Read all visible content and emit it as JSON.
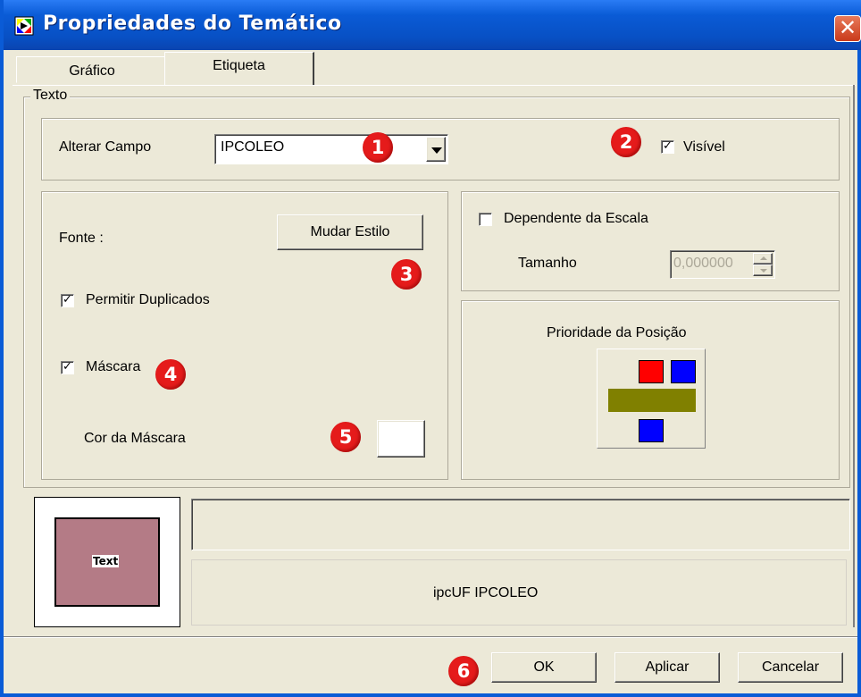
{
  "window": {
    "title": "Propriedades do Temático",
    "close_label": "✕"
  },
  "tabs": [
    {
      "label": "Gráfico",
      "active": false
    },
    {
      "label": "Etiqueta",
      "active": true
    }
  ],
  "texto_group": {
    "label": "Texto"
  },
  "campo": {
    "label": "Alterar Campo",
    "value": "IPCOLEO"
  },
  "visivel": {
    "label": "Visível",
    "checked": true
  },
  "fonte": {
    "label": "Fonte :",
    "button": "Mudar Estilo"
  },
  "permitir_duplicados": {
    "label": "Permitir Duplicados",
    "checked": true
  },
  "mascara": {
    "label": "Máscara",
    "checked": true
  },
  "cor_mascara": {
    "label": "Cor da Máscara",
    "color": "#ffffff"
  },
  "escala": {
    "label": "Dependente da Escala",
    "checked": false
  },
  "tamanho": {
    "label": "Tamanho",
    "value": "0,000000"
  },
  "prioridade": {
    "label": "Prioridade da Posição",
    "colors": {
      "red": "#ff0000",
      "blue": "#0000ff",
      "olive": "#808000"
    }
  },
  "preview": {
    "sample_text": "Text",
    "fill_color": "#b47b86",
    "caption": "ipcUF IPCOLEO"
  },
  "buttons": {
    "ok": "OK",
    "aplicar": "Aplicar",
    "cancelar": "Cancelar"
  },
  "badges": [
    "1",
    "2",
    "3",
    "4",
    "5",
    "6"
  ]
}
